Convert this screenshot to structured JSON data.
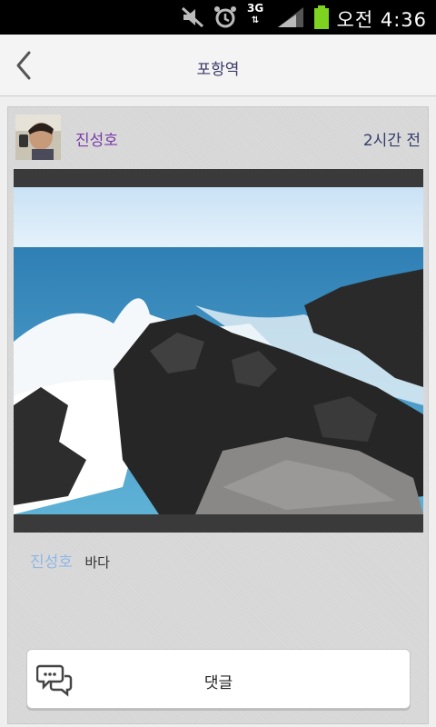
{
  "status_bar": {
    "network": "3G",
    "time": "오전 4:36",
    "icons": [
      "mute-icon",
      "alarm-icon",
      "signal-icon",
      "battery-icon"
    ],
    "battery_color": "#7ed321"
  },
  "header": {
    "title": "포항역",
    "back_icon": "chevron-left-icon"
  },
  "post": {
    "author": "진성호",
    "time_ago": "2시간 전",
    "caption_author": "진성호",
    "caption_text": "바다",
    "photo": "seaside-rocks-photo"
  },
  "actions": {
    "comment_label": "댓글",
    "comment_icon": "comment-bubbles-icon"
  },
  "colors": {
    "author": "#7a3aa8",
    "caption_author": "#8fb6e6",
    "title": "#3a3a6a"
  }
}
